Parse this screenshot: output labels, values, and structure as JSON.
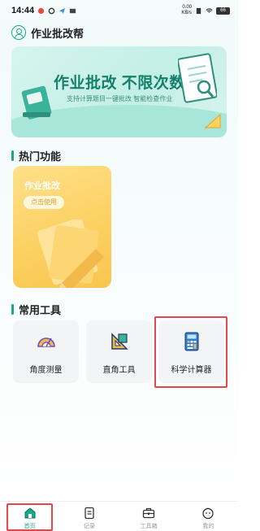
{
  "status_bar": {
    "time": "14:44",
    "speed_top": "0.00",
    "speed_unit": "KB/s",
    "battery": "66"
  },
  "header": {
    "title": "作业批改帮"
  },
  "banner": {
    "title": "作业批改 不限次数",
    "subtitle": "支持计算题目一键批改 智能检查作业"
  },
  "hot": {
    "section_title": "热门功能",
    "card_title": "作业批改",
    "card_button": "点击使用"
  },
  "tools": {
    "section_title": "常用工具",
    "items": [
      {
        "label": "角度测量",
        "icon": "protractor-icon"
      },
      {
        "label": "直角工具",
        "icon": "set-square-icon"
      },
      {
        "label": "科学计算器",
        "icon": "calculator-icon"
      }
    ]
  },
  "tabbar": {
    "items": [
      {
        "label": "首页",
        "icon": "home-icon",
        "active": true
      },
      {
        "label": "记录",
        "icon": "document-icon",
        "active": false
      },
      {
        "label": "工具箱",
        "icon": "toolbox-icon",
        "active": false
      },
      {
        "label": "我的",
        "icon": "profile-icon",
        "active": false
      }
    ]
  },
  "colors": {
    "accent": "#1aa88c",
    "highlight": "#e0484c",
    "feature_card": "#fccf5f"
  }
}
